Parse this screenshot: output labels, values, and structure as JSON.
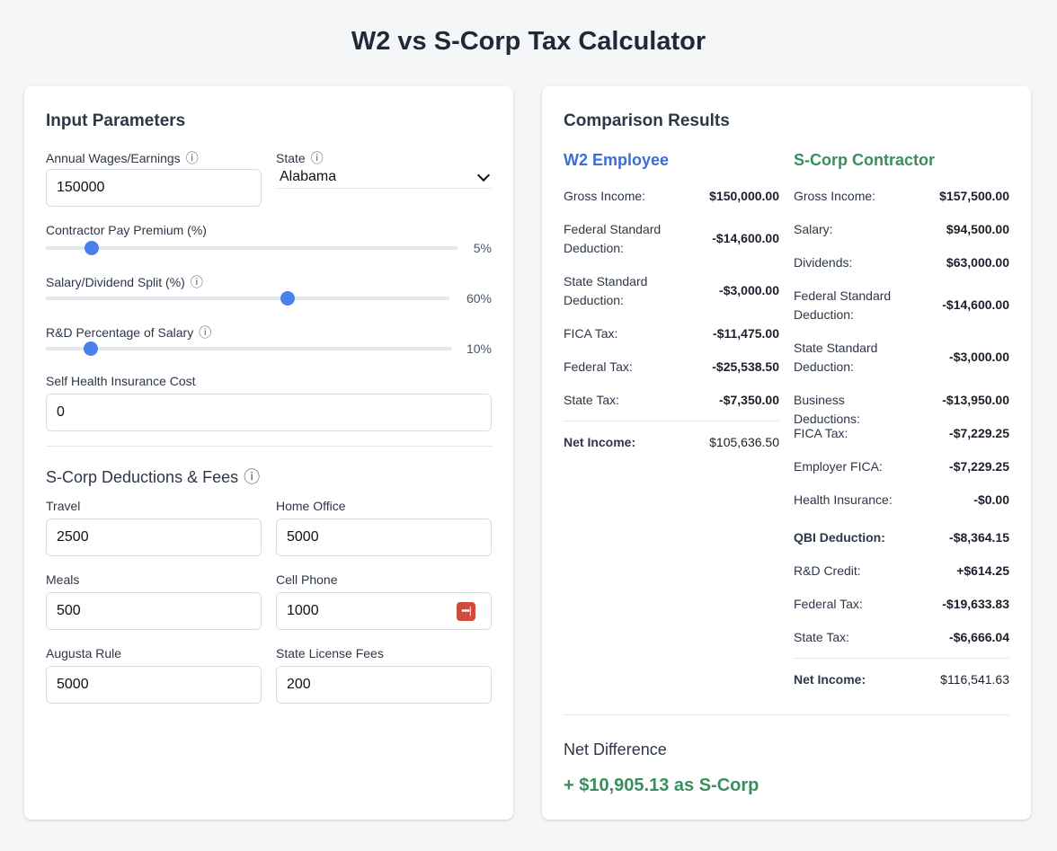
{
  "title": "W2 vs S-Corp Tax Calculator",
  "inputs": {
    "heading": "Input Parameters",
    "wages_label": "Annual Wages/Earnings",
    "wages_value": "150000",
    "state_label": "State",
    "state_value": "Alabama",
    "premium_label": "Contractor Pay Premium (%)",
    "premium_value": 5,
    "premium_display": "5%",
    "split_label": "Salary/Dividend Split (%)",
    "split_value": 60,
    "split_display": "60%",
    "rd_label": "R&D Percentage of Salary",
    "rd_value": 10,
    "rd_display": "10%",
    "health_label": "Self Health Insurance Cost",
    "health_value": "0",
    "info_icon": "ⓘ"
  },
  "deductions": {
    "heading": "S-Corp Deductions & Fees",
    "travel_label": "Travel",
    "travel_value": "2500",
    "home_label": "Home Office",
    "home_value": "5000",
    "meals_label": "Meals",
    "meals_value": "500",
    "cell_label": "Cell Phone",
    "cell_value": "1000",
    "augusta_label": "Augusta Rule",
    "augusta_value": "5000",
    "license_label": "State License Fees",
    "license_value": "200"
  },
  "results": {
    "heading": "Comparison Results",
    "w2": {
      "title": "W2 Employee",
      "color": "#3b6fd4",
      "rows": [
        {
          "label": "Gross Income:",
          "value": "$150,000.00"
        },
        {
          "label": "Federal Standard Deduction:",
          "value": "-$14,600.00"
        },
        {
          "label": "State Standard Deduction:",
          "value": "-$3,000.00"
        },
        {
          "label": "FICA Tax:",
          "value": "-$11,475.00"
        },
        {
          "label": "Federal Tax:",
          "value": "-$25,538.50"
        },
        {
          "label": "State Tax:",
          "value": "-$7,350.00"
        }
      ],
      "net_label": "Net Income:",
      "net_value": "$105,636.50"
    },
    "scorp": {
      "title": "S-Corp Contractor",
      "color": "#3a8e5e",
      "rows": [
        {
          "label": "Gross Income:",
          "value": "$157,500.00"
        },
        {
          "label": "Salary:",
          "value": "$94,500.00"
        },
        {
          "label": "Dividends:",
          "value": "$63,000.00"
        },
        {
          "label": "Federal Standard Deduction:",
          "value": "-$14,600.00"
        },
        {
          "label": "State Standard Deduction:",
          "value": "-$3,000.00"
        },
        {
          "label": "Business Deductions:",
          "value": "-$13,950.00"
        },
        {
          "label": "FICA Tax:",
          "value": "-$7,229.25"
        },
        {
          "label": "Employer FICA:",
          "value": "-$7,229.25"
        },
        {
          "label": "Health Insurance:",
          "value": "-$0.00"
        },
        {
          "label": "QBI Deduction:",
          "value": "-$8,364.15"
        },
        {
          "label": "R&D Credit:",
          "value": "+$614.25"
        },
        {
          "label": "Federal Tax:",
          "value": "-$19,633.83"
        },
        {
          "label": "State Tax:",
          "value": "-$6,666.04"
        }
      ],
      "net_label": "Net Income:",
      "net_value": "$116,541.63"
    },
    "net_difference_label": "Net Difference",
    "net_difference_value": "+ $10,905.13 as S-Corp"
  }
}
